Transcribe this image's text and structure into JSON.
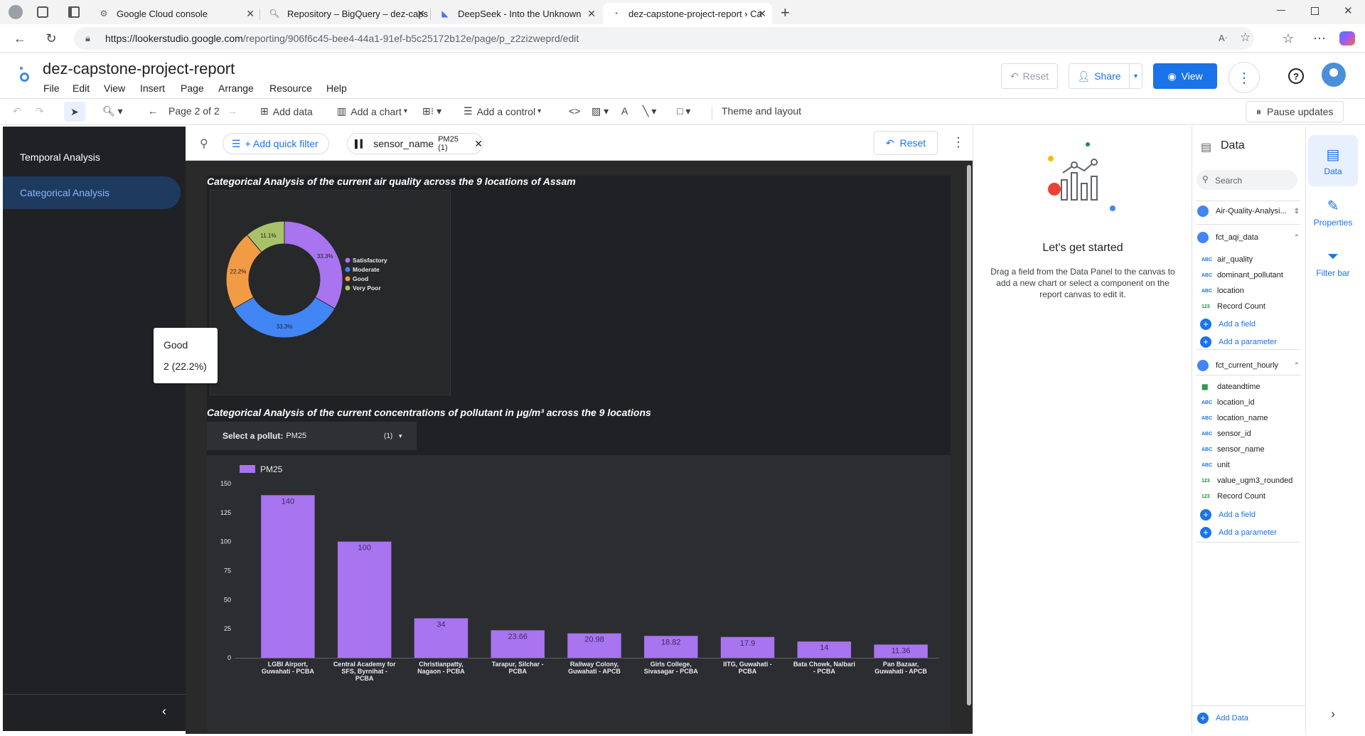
{
  "browser": {
    "tabs": [
      {
        "title": "Google Cloud console",
        "icon": "gear-icon"
      },
      {
        "title": "Repository – BigQuery – dez-caps",
        "icon": "search-icon"
      },
      {
        "title": "DeepSeek - Into the Unknown",
        "icon": "whale-icon"
      },
      {
        "title": "dez-capstone-project-report › Ca",
        "icon": "looker-icon"
      }
    ],
    "url_host": "https://lookerstudio.google.com",
    "url_path": "/reporting/906f6c45-bee4-44a1-91ef-b5c25172b12e/page/p_z2zizweprd/edit"
  },
  "app": {
    "title": "dez-capstone-project-report",
    "menus": [
      "File",
      "Edit",
      "View",
      "Insert",
      "Page",
      "Arrange",
      "Resource",
      "Help"
    ],
    "reset_label": "Reset",
    "share_label": "Share",
    "view_label": "View"
  },
  "toolbar": {
    "page_indicator": "Page 2 of 2",
    "add_data": "Add data",
    "add_chart": "Add a chart",
    "add_control": "Add a control",
    "theme_layout": "Theme and layout",
    "pause_updates": "Pause updates"
  },
  "pages": {
    "items": [
      "Temporal Analysis",
      "Categorical Analysis"
    ],
    "active": "Categorical Analysis"
  },
  "filterbar": {
    "add_quick_filter": "+ Add quick filter",
    "chip_field": "sensor_name",
    "chip_value": "PM25 (1)",
    "reset_label": "Reset"
  },
  "report": {
    "chart1_title": "Categorical Analysis of the current air quality across the 9 locations of Assam",
    "chart2_title": "Categorical Analysis of the current concentrations of pollutant in μg/m³ across the 9 locations",
    "selector_label": "Select a pollut:",
    "selector_value": "PM25",
    "selector_count": "(1)",
    "tooltip": {
      "label": "Good",
      "value": "2 (22.2%)"
    }
  },
  "chart_data": [
    {
      "type": "pie",
      "title": "Categorical Analysis of the current air quality across the 9 locations of Assam",
      "legend_position": "right",
      "slices": [
        {
          "name": "Satisfactory",
          "value": 33.3,
          "label": "33.3%",
          "color": "#a874f0"
        },
        {
          "name": "Moderate",
          "value": 33.3,
          "label": "33.3%",
          "color": "#4285f4"
        },
        {
          "name": "Good",
          "value": 22.2,
          "label": "22.2%",
          "color": "#f29b45"
        },
        {
          "name": "Very Poor",
          "value": 11.1,
          "label": "11.1%",
          "color": "#a8c26a"
        }
      ]
    },
    {
      "type": "bar",
      "title": "Categorical Analysis of the current concentrations of pollutant in μg/m³ across the 9 locations",
      "series": [
        {
          "name": "PM25",
          "color": "#a874f0",
          "values": [
            140,
            100,
            34,
            23.66,
            20.98,
            18.82,
            17.9,
            14,
            11.36
          ]
        }
      ],
      "categories": [
        "LGBI Airport, Guwahati - PCBA",
        "Central Academy for SFS, Byrnihat - PCBA",
        "Christianpatty, Nagaon - PCBA",
        "Tarapur, Silchar - PCBA",
        "Railway Colony, Guwahati - APCB",
        "Girls College, Sivasagar - PCBA",
        "IITG, Guwahati - PCBA",
        "Bata Chowk, Nalbari - PCBA",
        "Pan Bazaar, Guwahati - APCB"
      ],
      "category_lines": [
        [
          "LGBI Airport,",
          "Guwahati - PCBA"
        ],
        [
          "Central Academy for",
          "SFS, Byrnihat -",
          "PCBA"
        ],
        [
          "Christianpatty,",
          "Nagaon - PCBA"
        ],
        [
          "Tarapur, Silchar -",
          "PCBA"
        ],
        [
          "Railway Colony,",
          "Guwahati - APCB"
        ],
        [
          "Girls College,",
          "Sivasagar - PCBA"
        ],
        [
          "IITG, Guwahati -",
          "PCBA"
        ],
        [
          "Bata Chowk, Nalbari",
          "- PCBA"
        ],
        [
          "Pan Bazaar,",
          "Guwahati - APCB"
        ]
      ],
      "value_labels": [
        "140",
        "100",
        "34",
        "23.66",
        "20.98",
        "18.82",
        "17.9",
        "14",
        "11.36"
      ],
      "y_ticks": [
        0,
        25,
        50,
        75,
        100,
        125,
        150
      ],
      "ylim": [
        0,
        150
      ],
      "legend_position": "top-left"
    }
  ],
  "empty_panel": {
    "heading": "Let's get started",
    "body": "Drag a field from the Data Panel to the canvas to add a new chart or select a component on the report canvas to edit it."
  },
  "data_panel": {
    "title": "Data",
    "search_placeholder": "Search",
    "source_top": "Air-Quality-Analysi...",
    "source1": {
      "name": "fct_aqi_data",
      "fields": [
        {
          "type": "ABC",
          "name": "air_quality"
        },
        {
          "type": "ABC",
          "name": "dominant_pollutant"
        },
        {
          "type": "ABC",
          "name": "location"
        },
        {
          "type": "123",
          "name": "Record Count"
        }
      ]
    },
    "source2": {
      "name": "fct_current_hourly",
      "fields": [
        {
          "type": "date",
          "name": "dateandtime"
        },
        {
          "type": "ABC",
          "name": "location_id"
        },
        {
          "type": "ABC",
          "name": "location_name"
        },
        {
          "type": "ABC",
          "name": "sensor_id"
        },
        {
          "type": "ABC",
          "name": "sensor_name"
        },
        {
          "type": "ABC",
          "name": "unit"
        },
        {
          "type": "123",
          "name": "value_ugm3_rounded"
        },
        {
          "type": "123",
          "name": "Record Count"
        }
      ]
    },
    "add_field": "Add a field",
    "add_parameter": "Add a parameter",
    "add_data": "Add Data"
  },
  "side_tabs": [
    "Data",
    "Properties",
    "Filter bar"
  ]
}
